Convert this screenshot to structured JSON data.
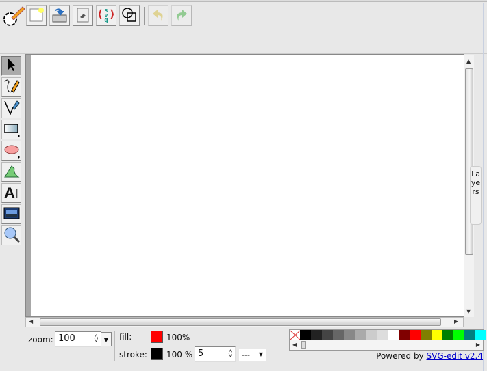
{
  "toolbar": {
    "buttons": [
      {
        "name": "logo",
        "icon": "svg-edit-logo-icon"
      },
      {
        "name": "new-image",
        "icon": "new-document-icon"
      },
      {
        "name": "save",
        "icon": "save-icon"
      },
      {
        "name": "document-properties",
        "icon": "document-properties-icon"
      },
      {
        "name": "source",
        "icon": "svg-source-icon",
        "label": "svg"
      },
      {
        "name": "wireframe",
        "icon": "wireframe-icon"
      },
      {
        "name": "undo",
        "icon": "undo-icon"
      },
      {
        "name": "redo",
        "icon": "redo-icon"
      }
    ]
  },
  "tools": [
    "select",
    "pencil",
    "line",
    "rectangle",
    "ellipse",
    "path",
    "text",
    "image",
    "zoom"
  ],
  "layers_label": "Layers",
  "bottom": {
    "zoom_label": "zoom:",
    "zoom_value": "100",
    "fill_label": "fill:",
    "fill_color": "#ff0000",
    "fill_opacity": "100%",
    "stroke_label": "stroke:",
    "stroke_color": "#000000",
    "stroke_opacity": "100 %",
    "stroke_width": "5",
    "stroke_dash": "---"
  },
  "palette": [
    "#000000",
    "#222222",
    "#444444",
    "#666666",
    "#888888",
    "#aaaaaa",
    "#cccccc",
    "#dddddd",
    "#ffffff",
    "#800000",
    "#ff0000",
    "#808000",
    "#ffff00",
    "#008000",
    "#00ff00",
    "#008080",
    "#00ffff"
  ],
  "footer": {
    "powered_by": "Powered by",
    "link": "SVG-edit v2.4"
  }
}
